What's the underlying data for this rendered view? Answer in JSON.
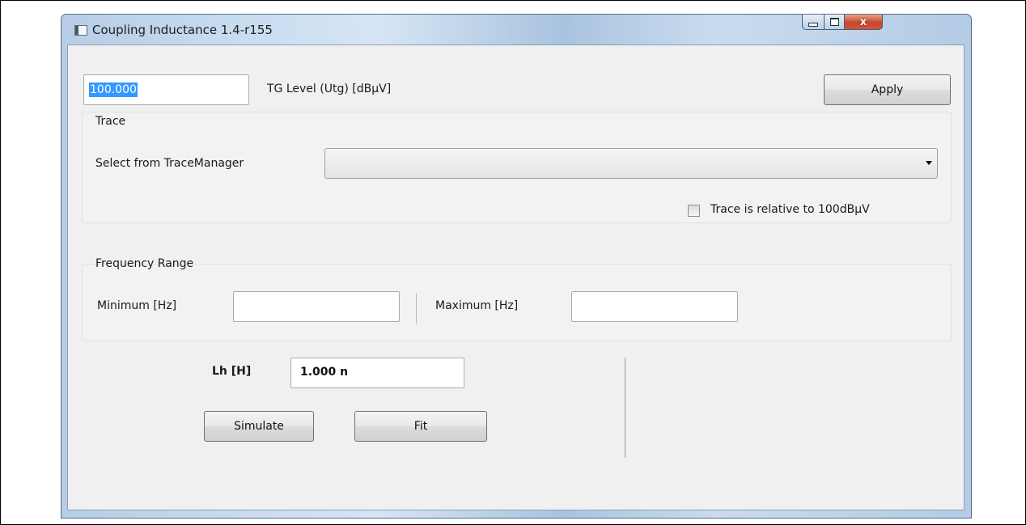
{
  "window": {
    "title": "Coupling Inductance 1.4-r155",
    "minimize_glyph": "",
    "close_glyph": "x"
  },
  "tg_level": {
    "value": "100.000",
    "label": "TG Level (Utg) [dBμV]"
  },
  "apply_label": "Apply",
  "trace": {
    "group_title": "Trace",
    "select_label": "Select from TraceManager",
    "selected_value": "",
    "relative_checkbox_label": "Trace is relative to 100dBμV",
    "relative_checked": false
  },
  "frequency_range": {
    "group_title": "Frequency Range",
    "min_label": "Minimum [Hz]",
    "min_value": "",
    "max_label": "Maximum [Hz]",
    "max_value": ""
  },
  "lh": {
    "label": "Lh [H]",
    "value": "1.000 n"
  },
  "buttons": {
    "simulate": "Simulate",
    "fit": "Fit"
  },
  "colors": {
    "selection_highlight": "#3399ff",
    "close_button": "#c9452b",
    "client_background": "#f0f0f0"
  },
  "icons": {
    "app": "app-window-icon",
    "minimize": "minimize-icon",
    "maximize": "maximize-icon",
    "close": "close-icon",
    "dropdown": "chevron-down-icon"
  }
}
